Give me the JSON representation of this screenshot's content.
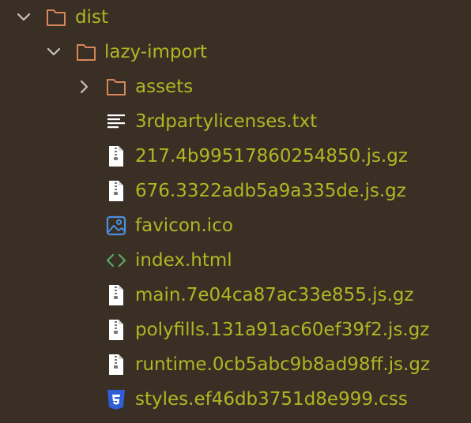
{
  "colors": {
    "background": "#3a2f24",
    "text": "#b1b624",
    "folder_stroke": "#d9865c",
    "chevron": "#c9c3b8",
    "file_icon": "#ffffff",
    "image_icon": "#4a8fe0",
    "html_icon": "#5aa866",
    "css_icon": "#2f5fd6"
  },
  "tree": {
    "items": [
      {
        "label": "dist",
        "kind": "folder",
        "expanded": true,
        "icon": "folder-icon",
        "chevron": "chevron-down-icon"
      },
      {
        "label": "lazy-import",
        "kind": "folder",
        "expanded": true,
        "icon": "folder-icon",
        "chevron": "chevron-down-icon"
      },
      {
        "label": "assets",
        "kind": "folder",
        "expanded": false,
        "icon": "folder-icon",
        "chevron": "chevron-right-icon"
      },
      {
        "label": "3rdpartylicenses.txt",
        "kind": "text-file",
        "icon": "text-file-icon"
      },
      {
        "label": "217.4b99517860254850.js.gz",
        "kind": "archive",
        "icon": "archive-file-icon"
      },
      {
        "label": "676.3322adb5a9a335de.js.gz",
        "kind": "archive",
        "icon": "archive-file-icon"
      },
      {
        "label": "favicon.ico",
        "kind": "image",
        "icon": "image-file-icon"
      },
      {
        "label": "index.html",
        "kind": "html",
        "icon": "html-code-icon"
      },
      {
        "label": "main.7e04ca87ac33e855.js.gz",
        "kind": "archive",
        "icon": "archive-file-icon"
      },
      {
        "label": "polyfills.131a91ac60ef39f2.js.gz",
        "kind": "archive",
        "icon": "archive-file-icon"
      },
      {
        "label": "runtime.0cb5abc9b8ad98ff.js.gz",
        "kind": "archive",
        "icon": "archive-file-icon"
      },
      {
        "label": "styles.ef46db3751d8e999.css",
        "kind": "css",
        "icon": "css-file-icon"
      }
    ]
  }
}
